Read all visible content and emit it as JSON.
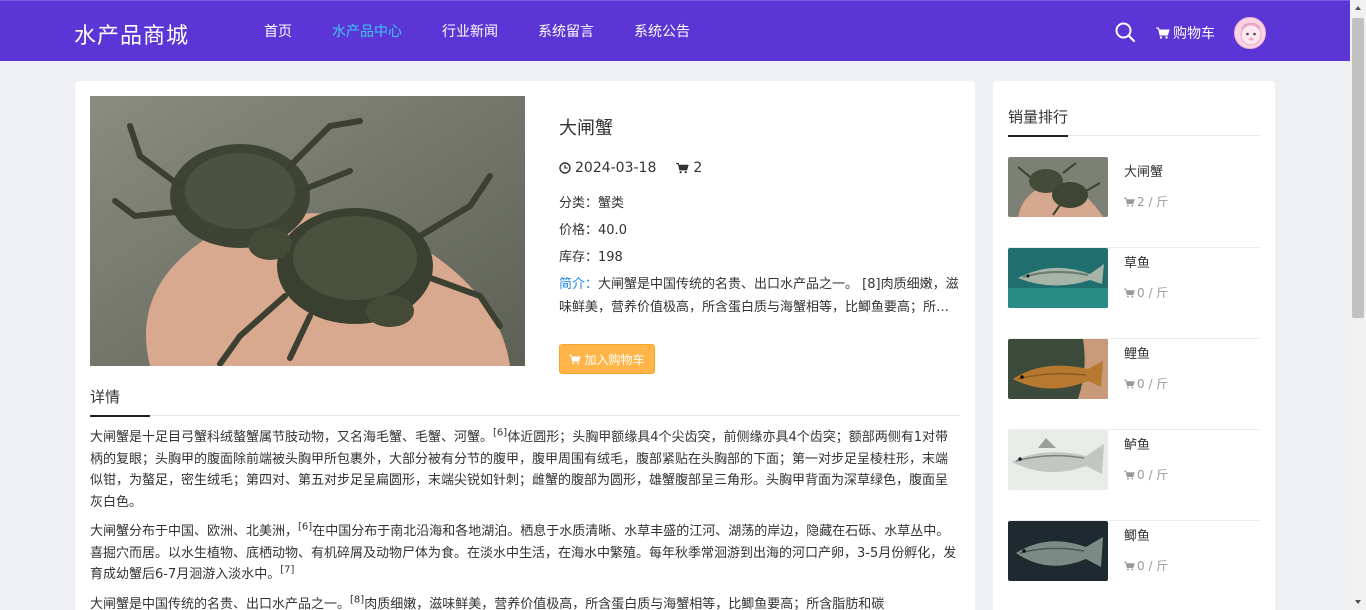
{
  "header": {
    "logo": "水产品商城",
    "nav": [
      "首页",
      "水产品中心",
      "行业新闻",
      "系统留言",
      "系统公告"
    ],
    "active_nav": "水产品中心",
    "cart_label": "购物车",
    "brand_color": "#5b35d5",
    "active_color": "#3ec6f0"
  },
  "product": {
    "title": "大闸蟹",
    "date": "2024-03-18",
    "cart_count": "2",
    "category_label": "分类：",
    "category": "蟹类",
    "price_label": "价格：",
    "price": "40.0",
    "stock_label": "库存：",
    "stock": "198",
    "intro_label": "简介：",
    "intro": "大闸蟹是中国传统的名贵、出口水产品之一。 [8]肉质细嫩，滋味鲜美，营养价值极高，所含蛋白质与海蟹相等，比鲫鱼要高；所含脂肪和碳水化合物也比一般的鱼高。",
    "add_cart_label": "加入购物车"
  },
  "detail": {
    "tab": "详情",
    "paragraphs": [
      {
        "parts": [
          "大闸蟹是十足目弓蟹科绒螯蟹属节肢动物，又名海毛蟹、毛蟹、河蟹。",
          "[6]",
          "体近圆形；头胸甲额缘具4个尖齿突，前侧缘亦具4个齿突；额部两侧有1对带柄的复眼；头胸甲的腹面除前端被头胸甲所包裹外，大部分被有分节的腹甲，腹甲周围有绒毛，腹部紧贴在头胸部的下面；第一对步足呈棱柱形，末端似钳，为螯足，密生绒毛；第四对、第五对步足呈扁圆形，末端尖锐如针刺；雌蟹的腹部为圆形，雄蟹腹部呈三角形。头胸甲背面为深草绿色，腹面呈灰白色。",
          ""
        ]
      },
      {
        "parts": [
          "大闸蟹分布于中国、欧洲、北美洲，",
          "[6]",
          "在中国分布于南北沿海和各地湖泊。栖息于水质清晰、水草丰盛的江河、湖荡的岸边，隐藏在石砾、水草丛中。喜掘穴而居。以水生植物、底栖动物、有机碎屑及动物尸体为食。在淡水中生活，在海水中繁殖。每年秋季常洄游到出海的河口产卵，3-5月份孵化，发育成幼蟹后6-7月洄游入淡水中。",
          "[7]"
        ]
      },
      {
        "parts": [
          "大闸蟹是中国传统的名贵、出口水产品之一。",
          "[8]",
          "肉质细嫩，滋味鲜美，营养价值极高，所含蛋白质与海蟹相等，比鲫鱼要高；所含脂肪和碳",
          ""
        ]
      }
    ]
  },
  "sidebar": {
    "title": "销量排行",
    "items": [
      {
        "name": "大闸蟹",
        "sales": "2 / 斤"
      },
      {
        "name": "草鱼",
        "sales": "0 / 斤"
      },
      {
        "name": "鲤鱼",
        "sales": "0 / 斤"
      },
      {
        "name": "鲈鱼",
        "sales": "0 / 斤"
      },
      {
        "name": "鲫鱼",
        "sales": "0 / 斤"
      }
    ]
  },
  "icons": {
    "search": "search-icon",
    "cart": "cart-icon",
    "clock": "clock-icon"
  },
  "colors": {
    "add_cart_button": "#ffb548",
    "intro_label": "#1e88e5"
  }
}
